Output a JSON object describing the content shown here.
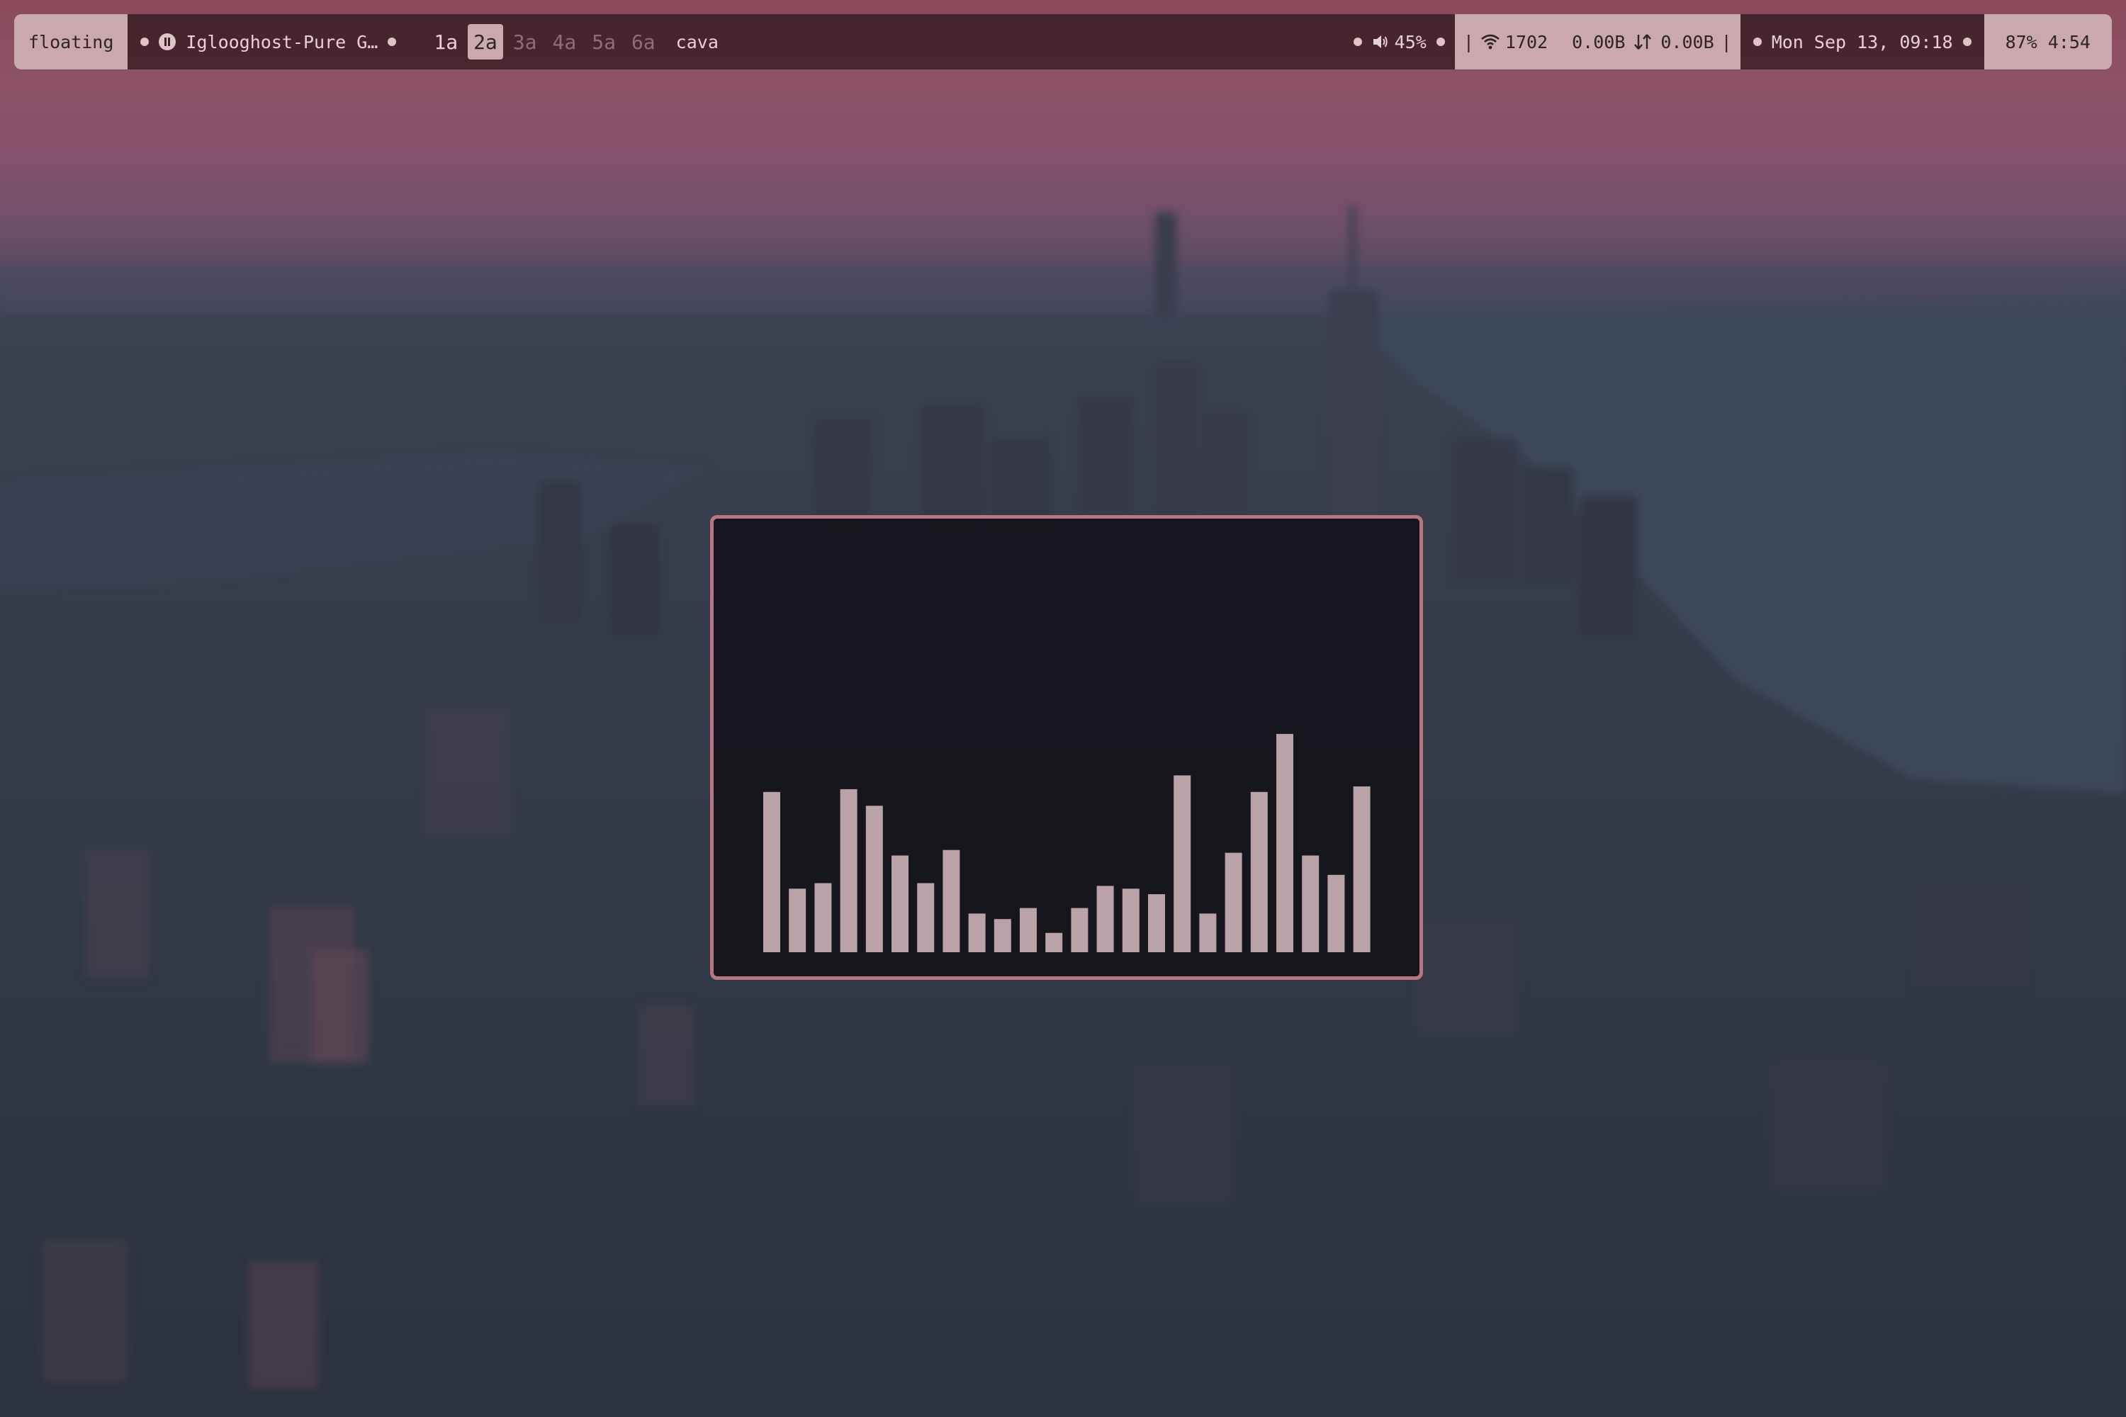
{
  "wallpaper": {
    "name": "city-dusk-wallpaper"
  },
  "bar": {
    "mode": "floating",
    "media": {
      "icon": "pause-icon",
      "title": "Iglooghost-Pure G…"
    },
    "workspaces": [
      {
        "label": "1a",
        "state": "occupied"
      },
      {
        "label": "2a",
        "state": "active"
      },
      {
        "label": "3a",
        "state": "inactive"
      },
      {
        "label": "4a",
        "state": "inactive"
      },
      {
        "label": "5a",
        "state": "inactive"
      },
      {
        "label": "6a",
        "state": "inactive"
      }
    ],
    "window_title": "cava",
    "volume": {
      "icon": "speaker-icon",
      "value": "45%"
    },
    "network": {
      "icon": "wifi-icon",
      "ssid": "1702",
      "down": "0.00B",
      "arrows_icon": "up-down-arrows-icon",
      "up": "0.00B"
    },
    "datetime": "Mon Sep 13, 09:18",
    "battery": "87% 4:54"
  },
  "cava": {
    "title": "cava",
    "bar_color": "#b9a3a9",
    "border_color": "#b87682",
    "levels": [
      0.58,
      0.23,
      0.25,
      0.59,
      0.53,
      0.35,
      0.25,
      0.37,
      0.14,
      0.12,
      0.16,
      0.07,
      0.16,
      0.24,
      0.23,
      0.21,
      0.64,
      0.14,
      0.36,
      0.58,
      0.79,
      0.35,
      0.28,
      0.6
    ]
  },
  "colors": {
    "bar_background": "#3e2028",
    "segment_light": "#c9a9ae",
    "text_light": "#e6d2d6",
    "inactive_workspace": "#8f6e76"
  }
}
